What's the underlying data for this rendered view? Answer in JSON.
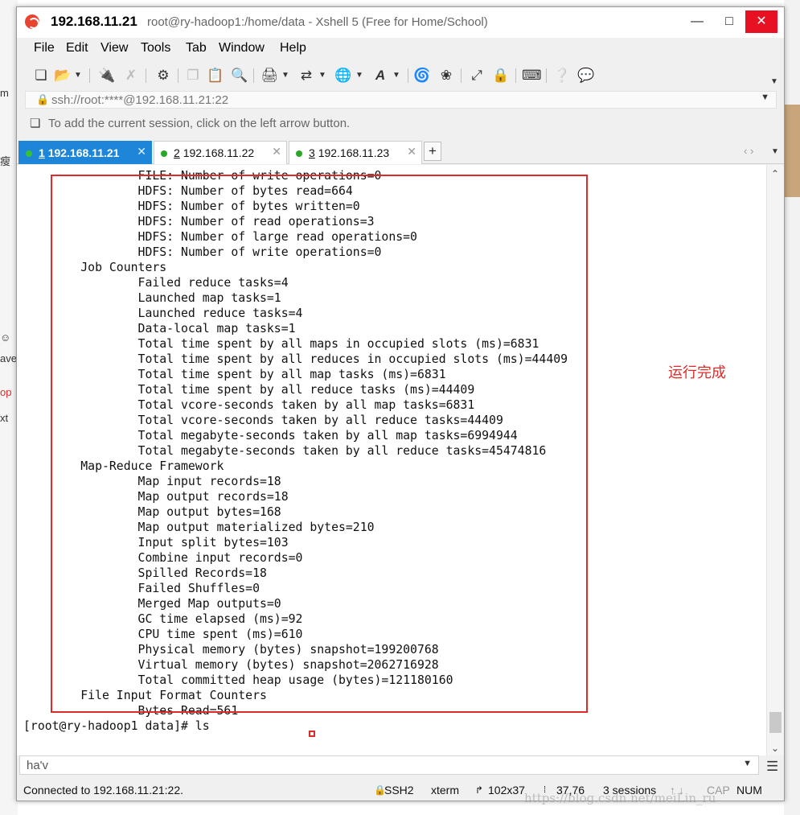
{
  "window": {
    "host": "192.168.11.21",
    "title": "root@ry-hadoop1:/home/data - Xshell 5 (Free for Home/School)"
  },
  "menu": [
    "File",
    "Edit",
    "View",
    "Tools",
    "Tab",
    "Window",
    "Help"
  ],
  "toolbar_icons": [
    "new-session-icon",
    "open-folder-icon",
    "connect-icon",
    "disconnect-icon",
    "properties-icon",
    "copy-icon",
    "paste-icon",
    "find-icon",
    "print-icon",
    "transfer-icon",
    "globe-icon",
    "font-icon",
    "xftp-icon",
    "xmanager-icon",
    "fullscreen-icon",
    "lock-icon",
    "keyboard-icon",
    "help-icon",
    "chat-icon"
  ],
  "address": {
    "url": "ssh://root:****@192.168.11.21:22"
  },
  "hint": "To add the current session, click on the left arrow button.",
  "tabs": [
    {
      "num": "1",
      "host": "192.168.11.21",
      "active": true
    },
    {
      "num": "2",
      "host": "192.168.11.22",
      "active": false
    },
    {
      "num": "3",
      "host": "192.168.11.23",
      "active": false
    }
  ],
  "terminal": {
    "lines": [
      "                FILE: Number of write operations=0",
      "                HDFS: Number of bytes read=664",
      "                HDFS: Number of bytes written=0",
      "                HDFS: Number of read operations=3",
      "                HDFS: Number of large read operations=0",
      "                HDFS: Number of write operations=0",
      "        Job Counters ",
      "                Failed reduce tasks=4",
      "                Launched map tasks=1",
      "                Launched reduce tasks=4",
      "                Data-local map tasks=1",
      "                Total time spent by all maps in occupied slots (ms)=6831",
      "                Total time spent by all reduces in occupied slots (ms)=44409",
      "                Total time spent by all map tasks (ms)=6831",
      "                Total time spent by all reduce tasks (ms)=44409",
      "                Total vcore-seconds taken by all map tasks=6831",
      "                Total vcore-seconds taken by all reduce tasks=44409",
      "                Total megabyte-seconds taken by all map tasks=6994944",
      "                Total megabyte-seconds taken by all reduce tasks=45474816",
      "        Map-Reduce Framework",
      "                Map input records=18",
      "                Map output records=18",
      "                Map output bytes=168",
      "                Map output materialized bytes=210",
      "                Input split bytes=103",
      "                Combine input records=0",
      "                Spilled Records=18",
      "                Failed Shuffles=0",
      "                Merged Map outputs=0",
      "                GC time elapsed (ms)=92",
      "                CPU time spent (ms)=610",
      "                Physical memory (bytes) snapshot=199200768",
      "                Virtual memory (bytes) snapshot=2062716928",
      "                Total committed heap usage (bytes)=121180160",
      "        File Input Format Counters ",
      "                Bytes Read=561",
      "[root@ry-hadoop1 data]# ls"
    ],
    "annotation": "运行完成"
  },
  "compose": {
    "value": "ha'v"
  },
  "status": {
    "connection": "Connected to 192.168.11.21:22.",
    "protocol": "SSH2",
    "term_type": "xterm",
    "size": "102x37",
    "cursor_pos": "37,76",
    "sessions": "3 sessions",
    "cap": "CAP",
    "num": "NUM"
  },
  "watermark": "https://blog.csdn.net/meiLin_ru",
  "colors": {
    "active_tab": "#1e86d8",
    "highlight_box": "#e02a2a",
    "close_button": "#e81123",
    "session_dot": "#28a828"
  }
}
